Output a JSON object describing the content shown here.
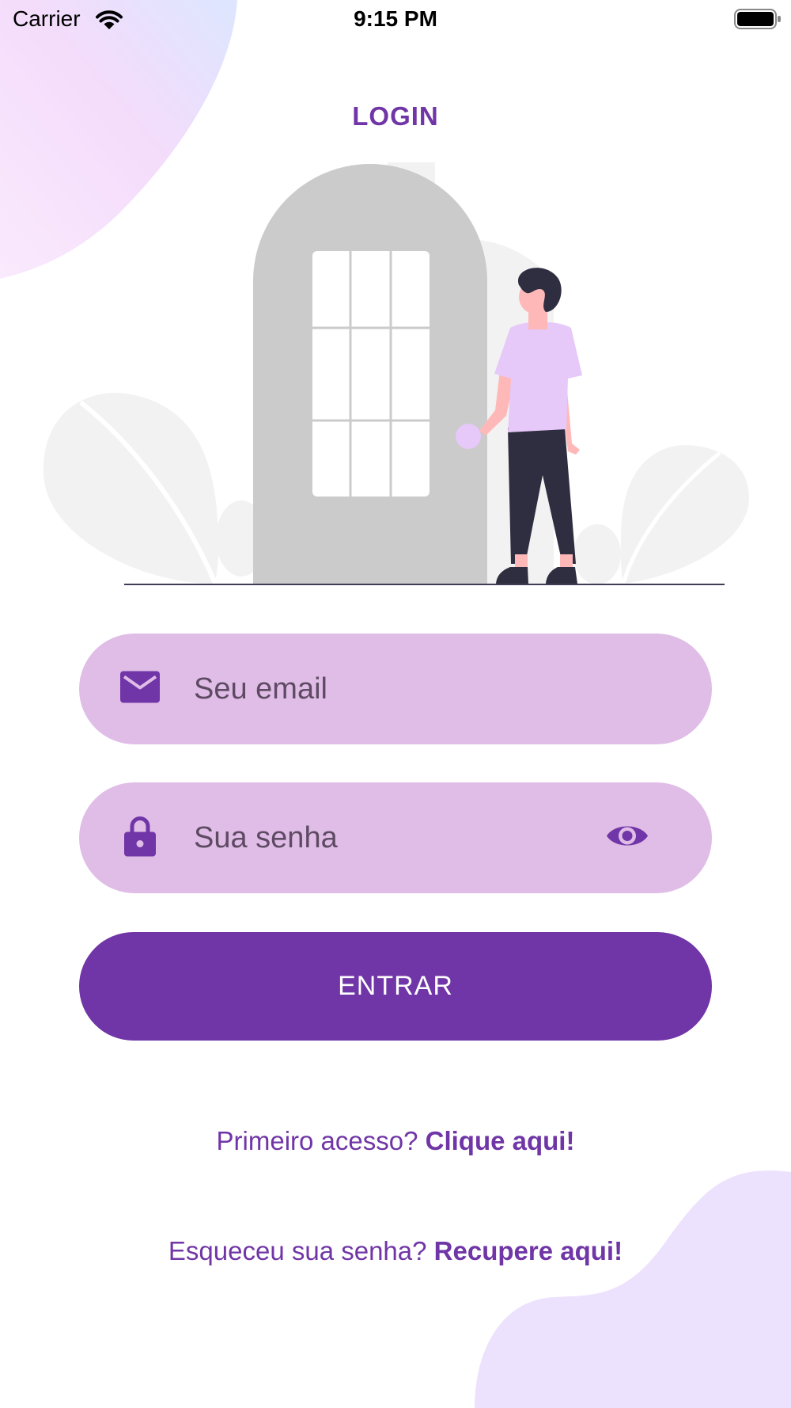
{
  "status_bar": {
    "carrier": "Carrier",
    "time": "9:15 PM",
    "wifi_icon": "wifi-icon",
    "battery_icon": "battery-full-icon"
  },
  "page": {
    "title": "LOGIN"
  },
  "form": {
    "email": {
      "placeholder": "Seu email",
      "value": "",
      "icon": "envelope-icon"
    },
    "password": {
      "placeholder": "Sua senha",
      "value": "",
      "icon": "lock-icon",
      "toggle_icon": "eye-icon"
    },
    "submit_label": "ENTRAR"
  },
  "links": {
    "first_access_prompt": "Primeiro acesso?",
    "first_access_link": "Clique aqui!",
    "forgot_prompt": "Esqueceu sua senha?",
    "forgot_link": "Recupere aqui!"
  },
  "colors": {
    "primary": "#7035a6",
    "field_background": "#e0bde7",
    "text_on_field": "#5e4b63",
    "background": "#ffffff",
    "blob_top_left": "#f3d9fb",
    "blob_bottom_right": "#ede1fd"
  }
}
